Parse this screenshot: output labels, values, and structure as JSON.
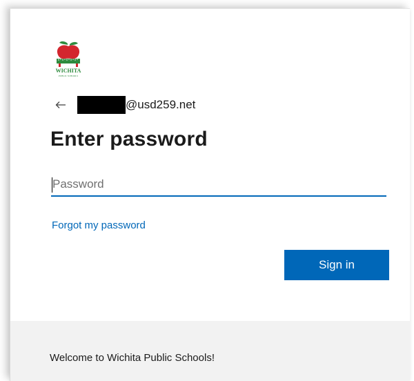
{
  "login": {
    "logo_name": "WICHITA",
    "logo_subtext": "PUBLIC SCHOOLS",
    "email_domain": "@usd259.net",
    "heading": "Enter password",
    "password_placeholder": "Password",
    "password_value": "",
    "forgot_link": "Forgot my password",
    "signin_label": "Sign in",
    "footer_text": "Welcome to Wichita Public Schools!"
  },
  "colors": {
    "accent": "#0067b8",
    "apple_red": "#d3262e",
    "logo_green": "#2e8b3e",
    "footer_bg": "#f2f2f2"
  },
  "icons": {
    "back": "back-arrow-icon",
    "logo": "apple-logo-icon"
  }
}
